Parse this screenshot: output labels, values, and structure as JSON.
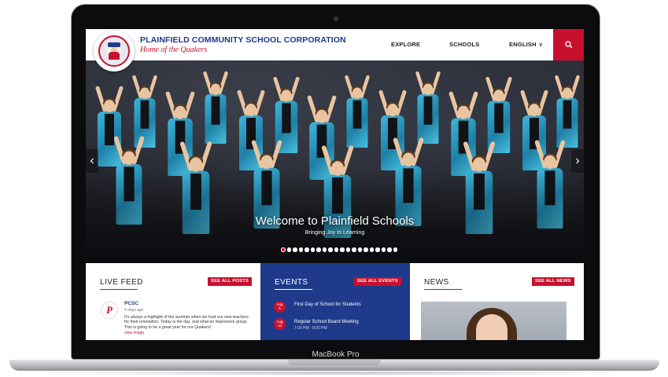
{
  "device": {
    "label": "MacBook Pro"
  },
  "header": {
    "school_name": "PLAINFIELD COMMUNITY SCHOOL CORPORATION",
    "tagline": "Home of the Quakers",
    "nav": {
      "explore": "EXPLORE",
      "schools": "SCHOOLS",
      "language": "ENGLISH"
    },
    "search_icon": "search-icon"
  },
  "hero": {
    "title": "Welcome to Plainfield Schools",
    "subtitle": "Bringing Joy to Learning",
    "slide_count": 20,
    "active_slide": 1
  },
  "live_feed": {
    "title": "LIVE FEED",
    "see_all": "SEE ALL POSTS",
    "post": {
      "avatar_letter": "P",
      "author": "PCSC",
      "time": "4 days ago",
      "text": "It's always a highlight of the summer when we host our new teachers for their orientation. Today is the day, and what an impressive group. This is going to be a great year for our Quakers!",
      "more": "view image"
    }
  },
  "events": {
    "title": "EVENTS",
    "see_all": "SEE ALL EVENTS",
    "items": [
      {
        "month": "Aug",
        "day": "5",
        "name": "First Day of School for Students",
        "time": ""
      },
      {
        "month": "Aug",
        "day": "13",
        "name": "Regular School Board Meeting",
        "time": "7:00 PM - 8:00 PM"
      }
    ]
  },
  "news": {
    "title": "NEWS",
    "see_all": "SEE ALL NEWS"
  },
  "colors": {
    "brand_blue": "#1f3a8a",
    "brand_red": "#c8102e"
  }
}
